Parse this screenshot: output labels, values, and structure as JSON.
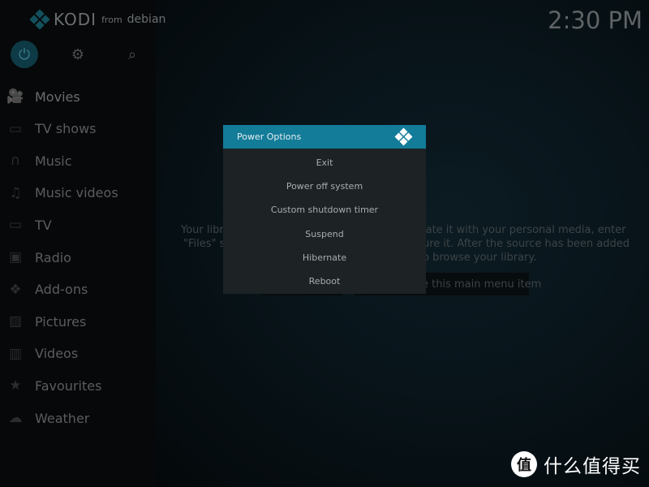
{
  "header": {
    "brand": "KODI",
    "brand_from": "from",
    "brand_distro": "debian",
    "clock": "2:30 PM"
  },
  "topbar": {
    "power": "power-icon",
    "settings": "gear-icon",
    "search": "search-icon"
  },
  "sidebar": {
    "items": [
      {
        "label": "Movies",
        "icon": "movie-camera-icon"
      },
      {
        "label": "TV shows",
        "icon": "tv-icon"
      },
      {
        "label": "Music",
        "icon": "headphones-icon"
      },
      {
        "label": "Music videos",
        "icon": "music-video-icon"
      },
      {
        "label": "TV",
        "icon": "tv-antenna-icon"
      },
      {
        "label": "Radio",
        "icon": "radio-icon"
      },
      {
        "label": "Add-ons",
        "icon": "addons-box-icon"
      },
      {
        "label": "Pictures",
        "icon": "picture-icon"
      },
      {
        "label": "Videos",
        "icon": "film-icon"
      },
      {
        "label": "Favourites",
        "icon": "star-icon"
      },
      {
        "label": "Weather",
        "icon": "weather-icon"
      }
    ]
  },
  "background": {
    "line1_left": "Your libr",
    "line1_right": "late it with your personal media, enter",
    "line2_left": "\"Files\" s",
    "line2_right": "ure it. After the source has been added",
    "line3_right": "o browse your library.",
    "button2_partial": "e this main menu item"
  },
  "dialog": {
    "title": "Power Options",
    "options": [
      "Exit",
      "Power off system",
      "Custom shutdown timer",
      "Suspend",
      "Hibernate",
      "Reboot"
    ]
  },
  "watermark": {
    "badge": "值",
    "text": "什么值得买"
  },
  "colors": {
    "accent": "#127c99",
    "dialog_bg": "#1d2224"
  }
}
